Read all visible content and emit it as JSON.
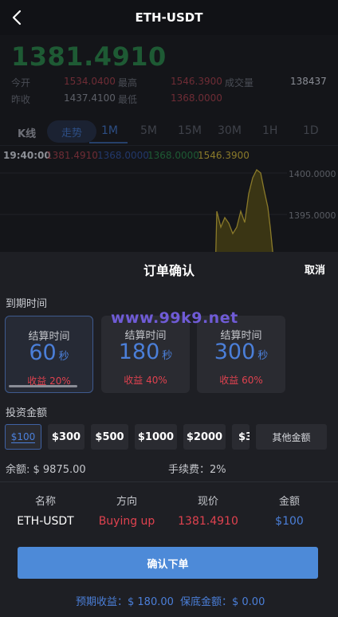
{
  "header": {
    "title": "ETH-USDT",
    "back_icon": "chevron-left-icon"
  },
  "background": {
    "price": "1381.4910",
    "stats": {
      "open_label": "今开",
      "open": "1534.0400",
      "high_label": "最高",
      "high": "1546.3900",
      "volume_label": "成交量",
      "volume": "138437",
      "prev_close_label": "昨收",
      "prev_close": "1437.4100",
      "low_label": "最低",
      "low": "1368.0000"
    },
    "tabs": [
      "K线",
      "走势",
      "1M",
      "5M",
      "15M",
      "30M",
      "1H",
      "1D"
    ],
    "active_tab": "1M",
    "chart_info": {
      "time": "19:40:00",
      "v1": "1381.4910",
      "v2": "1368.0000",
      "v3": "1368.0000",
      "v4": "1546.3900"
    },
    "chart_data": {
      "type": "area",
      "y_ticks": [
        "1400.0000",
        "1395.0000"
      ]
    },
    "colors": {
      "up_green": "#1e5a34",
      "down_red": "#e0424f",
      "accent_blue": "#4d8ad8",
      "chart_gold": "#8a7a2a"
    }
  },
  "modal": {
    "title": "订单确认",
    "cancel": "取消",
    "period_label": "到期时间",
    "periods": [
      {
        "label": "结算时间",
        "value": "60",
        "unit": "秒",
        "yield": "收益 20%"
      },
      {
        "label": "结算时间",
        "value": "180",
        "unit": "秒",
        "yield": "收益 40%"
      },
      {
        "label": "结算时间",
        "value": "300",
        "unit": "秒",
        "yield": "收益 60%"
      }
    ],
    "amount_label": "投资金额",
    "amounts": [
      "$100",
      "$300",
      "$500",
      "$1000",
      "$2000",
      "$3"
    ],
    "other_amount": "其他金额",
    "balance": "余额: $ 9875.00",
    "fee": "手续费：2%",
    "table": {
      "headers": [
        "名称",
        "方向",
        "现价",
        "金额"
      ],
      "row": [
        "ETH-USDT",
        "Buying up",
        "1381.4910",
        "$100"
      ]
    },
    "confirm": "确认下单",
    "expected": "预期收益：$ 180.00",
    "margin": "保底金额：$ 0.00"
  },
  "watermark": "www.99k9.net"
}
